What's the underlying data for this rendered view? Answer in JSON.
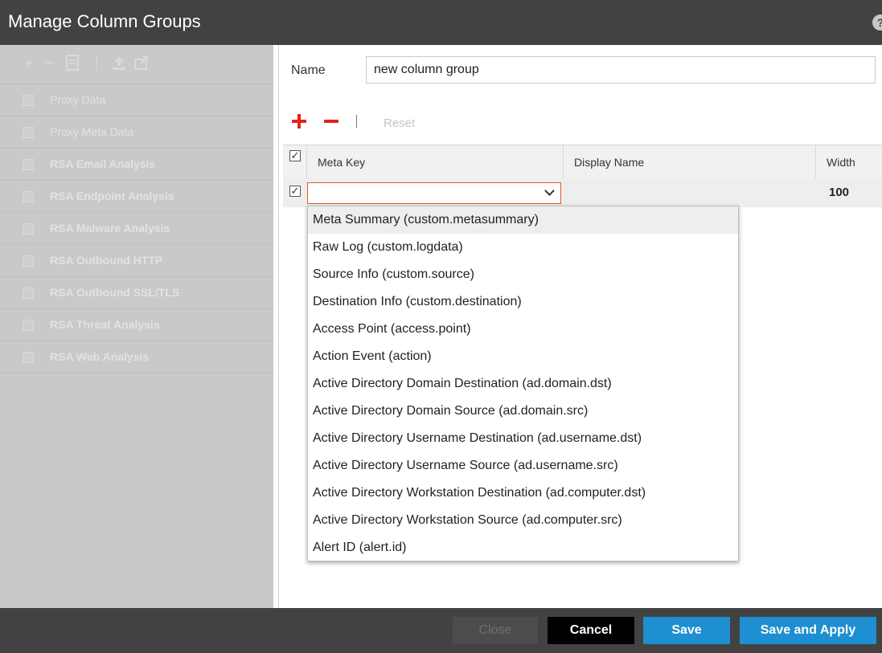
{
  "dialog": {
    "title": "Manage Column Groups",
    "help_icon": "?"
  },
  "left_panel": {
    "toolbar_icons": [
      "plus-icon",
      "minus-icon",
      "copy-icon",
      "import-icon",
      "export-icon"
    ],
    "groups": [
      {
        "label": "Proxy Data",
        "bold": false
      },
      {
        "label": "Proxy Meta Data",
        "bold": false
      },
      {
        "label": "RSA Email Analysis",
        "bold": true
      },
      {
        "label": "RSA Endpoint Analysis",
        "bold": true
      },
      {
        "label": "RSA Malware Analysis",
        "bold": true
      },
      {
        "label": "RSA Outbound HTTP",
        "bold": true
      },
      {
        "label": "RSA Outbound SSL/TLS",
        "bold": true
      },
      {
        "label": "RSA Threat Analysis",
        "bold": true
      },
      {
        "label": "RSA Web Analysis",
        "bold": true
      }
    ]
  },
  "form": {
    "name_label": "Name",
    "name_value": "new column group",
    "reset_label": "Reset"
  },
  "grid": {
    "headers": {
      "meta_key": "Meta Key",
      "display_name": "Display Name",
      "width": "Width"
    },
    "rows": [
      {
        "checked": true,
        "meta_key": "",
        "display_name": "",
        "width": "100"
      }
    ]
  },
  "dropdown": {
    "options": [
      "Meta Summary (custom.metasummary)",
      "Raw Log (custom.logdata)",
      "Source Info (custom.source)",
      "Destination Info (custom.destination)",
      "Access Point (access.point)",
      "Action Event (action)",
      "Active Directory Domain Destination (ad.domain.dst)",
      "Active Directory Domain Source (ad.domain.src)",
      "Active Directory Username Destination (ad.username.dst)",
      "Active Directory Username Source (ad.username.src)",
      "Active Directory Workstation Destination (ad.computer.dst)",
      "Active Directory Workstation Source (ad.computer.src)",
      "Alert ID (alert.id)"
    ],
    "highlighted_index": 0
  },
  "footer": {
    "close_label": "Close",
    "cancel_label": "Cancel",
    "save_label": "Save",
    "save_apply_label": "Save and Apply"
  },
  "colors": {
    "accent_blue": "#1e8fd0",
    "add_remove_red": "#e3241b",
    "title_bar": "#424242",
    "combo_border": "#e05a2a"
  }
}
